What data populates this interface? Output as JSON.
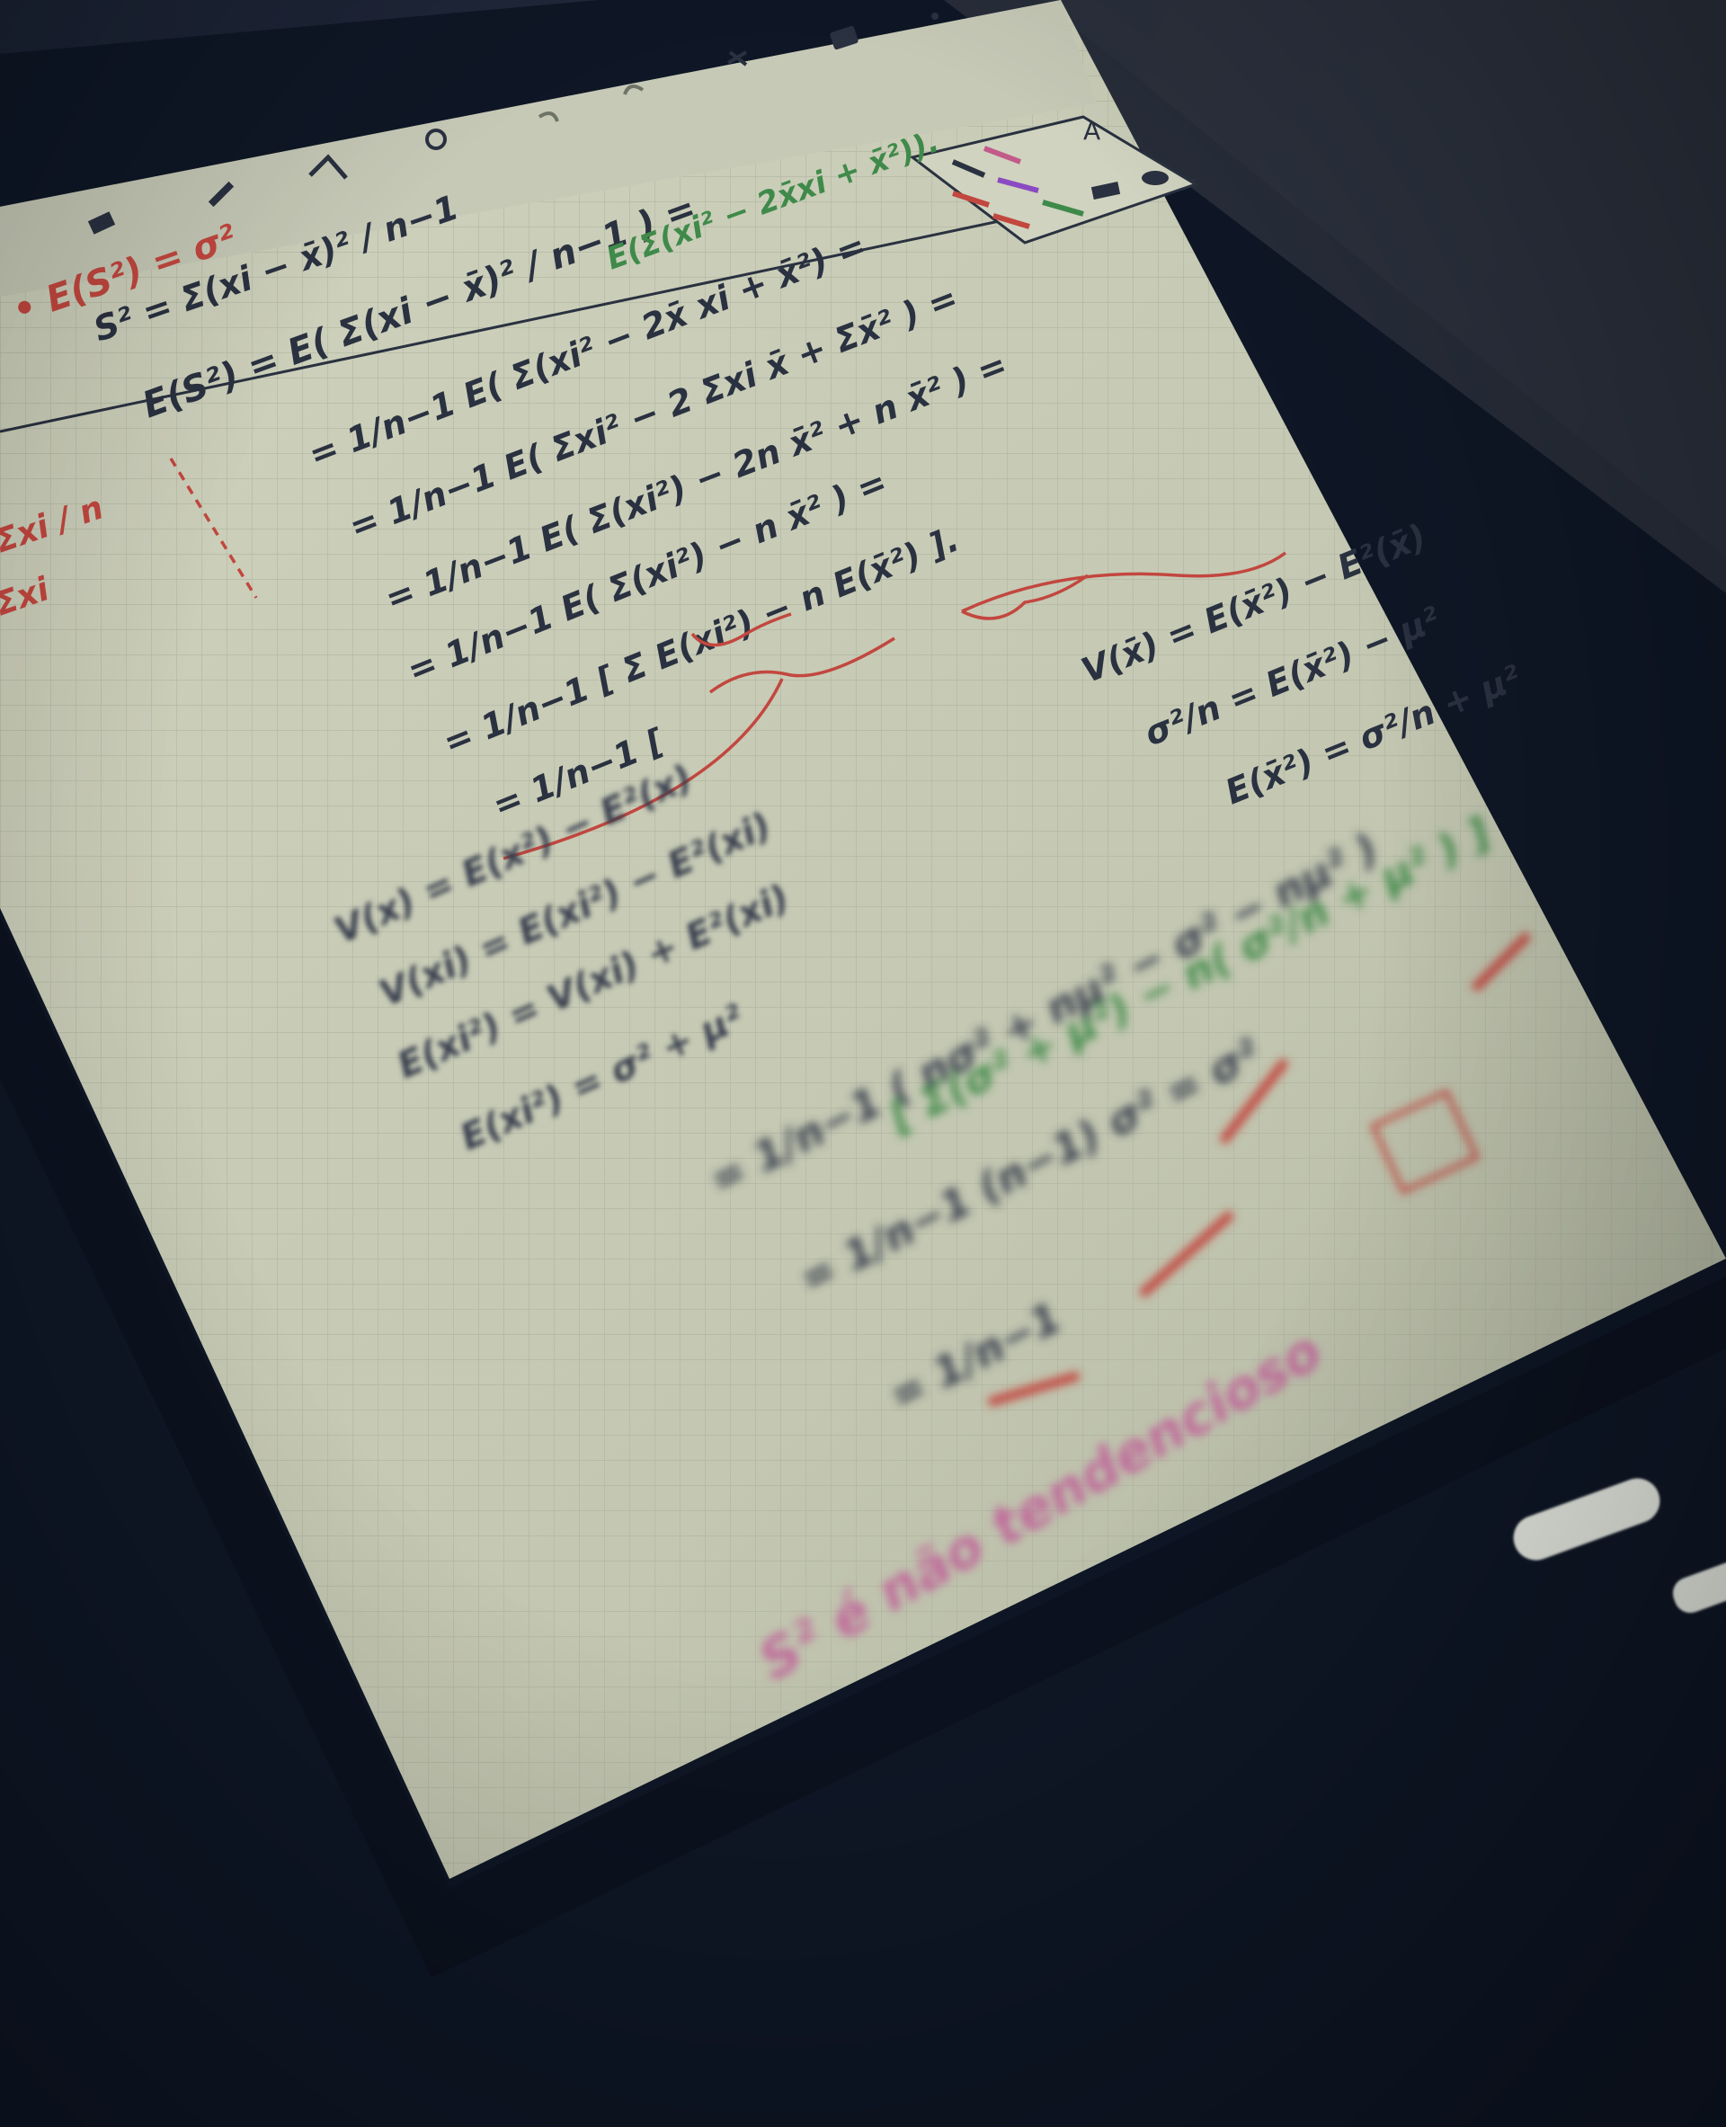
{
  "scene": {
    "subject": "tablet-handwritten-notes",
    "colors": {
      "background": "#1b2434",
      "bezel": "#0f1726",
      "paper": "#c9ccb8",
      "grid": "#a9ae9c",
      "ink_dark": "#2a3140",
      "ink_red": "#c2473f",
      "ink_green": "#3f8a4a",
      "ink_pink": "#c06a9a"
    }
  },
  "toolbar": {
    "icons": [
      "eraser-icon",
      "pen-icon",
      "lasso-icon",
      "search-icon",
      "undo-icon",
      "redo-icon",
      "scissors-icon",
      "camera-icon",
      "more-icon"
    ]
  },
  "palette": {
    "text_tool_label": "A"
  },
  "notes": {
    "line1": "• E(S²) = σ²",
    "line2": "S² = Σ(xi − x̄)² / n−1",
    "line3": "E(S²) = E( Σ(xi − x̄)² / n−1 ) =",
    "line3b": "E(Σ(xi² − 2x̄xi + x̄²)).",
    "line4": "= 1/n−1  E( Σ(xi² − 2x̄ xi + x̄²) =",
    "line5": "= 1/n−1  E( Σxi² − 2 Σxi x̄ + Σx̄² ) =",
    "line6": "= 1/n−1  E( Σ(xi²) − 2n x̄² + n x̄² ) =",
    "line7": "= 1/n−1  E( Σ(xi²) − n x̄² ) =",
    "line8": "= 1/n−1 [ Σ E(xi²) − n E(x̄²) ].",
    "line9": "= 1/n−1 [",
    "right1": "V(x̄) = E(x̄²) − E²(x̄)",
    "right2": "σ²/n = E(x̄²) − μ²",
    "right3": "E(x̄²) = σ²/n + μ²",
    "margin1": "Σxi / n",
    "margin2": "Σxi",
    "low1": "V(x) = E(x²) − E²(x)",
    "low2": "V(xi) = E(xi²) − E²(xi)",
    "low3": "E(xi²) = V(xi) + E²(xi)",
    "low4": "E(xi²) = σ² + μ²",
    "bottom1": "[ Σ(σ² + μ²) − n( σ²/n + μ² ) ]",
    "bottom2": "= 1/n−1 ( nσ² + nμ² − σ² − nμ² )",
    "bottom3": "= 1/n−1 (n−1) σ² = σ²",
    "bottom4": "= 1/n−1",
    "pink": "S² é não tendencioso"
  }
}
